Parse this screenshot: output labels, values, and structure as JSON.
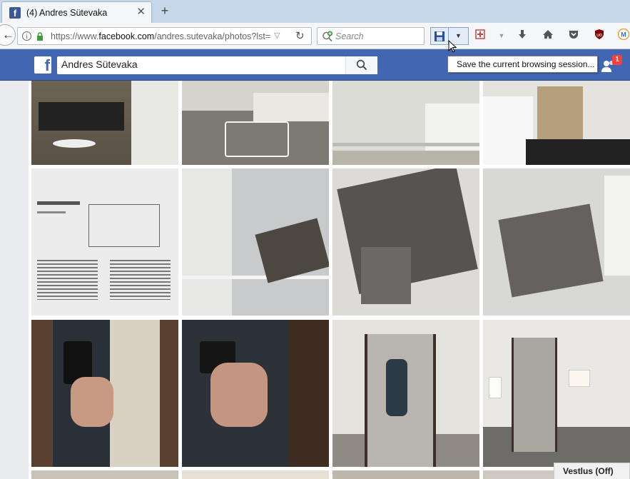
{
  "browser": {
    "tab": {
      "title": "(4) Andres Sütevaka",
      "favicon": "facebook-icon",
      "close_glyph": "✕"
    },
    "new_tab_glyph": "+",
    "url": {
      "prefix": "https://www.",
      "domain": "facebook.com",
      "path": "/andres.sutevaka/photos?lst="
    },
    "search_placeholder": "Search",
    "tooltip": "Save the current browsing session..."
  },
  "facebook": {
    "logo": "f",
    "search_value": "Andres Sütevaka",
    "friend_requests_count": "1"
  },
  "status_chip": "Vestlus (Off)",
  "colors": {
    "fb_blue": "#4267b2",
    "tab_strip": "#c7d7ea",
    "badge_red": "#fa3e3e"
  },
  "photos": [
    {
      "name": "street-building-photo",
      "label": ""
    },
    {
      "name": "terrace-chairs-photo",
      "label": ""
    },
    {
      "name": "white-building-railing-photo",
      "label": ""
    },
    {
      "name": "gallery-wall-artwork-photo",
      "label": ""
    },
    {
      "name": "artwork-label-photo",
      "label": ""
    },
    {
      "name": "chairs-installation-photo",
      "label": ""
    },
    {
      "name": "draped-frames-photo",
      "label": ""
    },
    {
      "name": "installation-corner-photo",
      "label": ""
    },
    {
      "name": "mirror-selfie-photo",
      "label": ""
    },
    {
      "name": "mirror-selfie-close-photo",
      "label": ""
    },
    {
      "name": "mirror-tower-photo",
      "label": ""
    },
    {
      "name": "mirror-tower-gallery-photo",
      "label": ""
    }
  ]
}
